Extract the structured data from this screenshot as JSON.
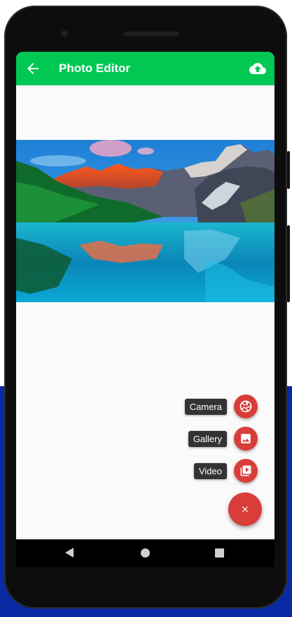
{
  "app_bar": {
    "title": "Photo Editor",
    "background_color": "#00c853",
    "back_icon": "arrow-back-icon",
    "upload_icon": "cloud-upload-icon"
  },
  "photo": {
    "subject": "mountain-lake-landscape"
  },
  "fab_menu": {
    "accent_color": "#d93d3a",
    "items": [
      {
        "label": "Camera",
        "icon": "camera-shutter-icon"
      },
      {
        "label": "Gallery",
        "icon": "image-icon"
      },
      {
        "label": "Video",
        "icon": "video-library-icon"
      }
    ],
    "main_icon": "close-icon"
  },
  "system_nav": {
    "back": "nav-back-icon",
    "home": "nav-home-icon",
    "recents": "nav-recents-icon"
  }
}
